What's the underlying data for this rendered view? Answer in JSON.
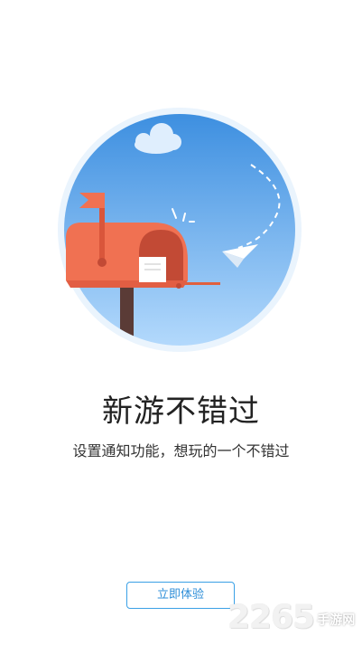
{
  "guide": {
    "headline": "新游不错过",
    "subline": "设置通知功能，想玩的一个不错过",
    "cta_label": "立即体验"
  },
  "illustration": {
    "icons": [
      "mailbox-icon",
      "flag-icon",
      "cloud-icon",
      "paper-plane-icon",
      "letter-icon"
    ]
  },
  "watermark": {
    "number": "2265",
    "site": "手游网"
  },
  "colors": {
    "sky_top": "#3d8fe0",
    "sky_bottom": "#a9d2fb",
    "mailbox": "#f07152",
    "accent_button": "#3aa0e6"
  }
}
